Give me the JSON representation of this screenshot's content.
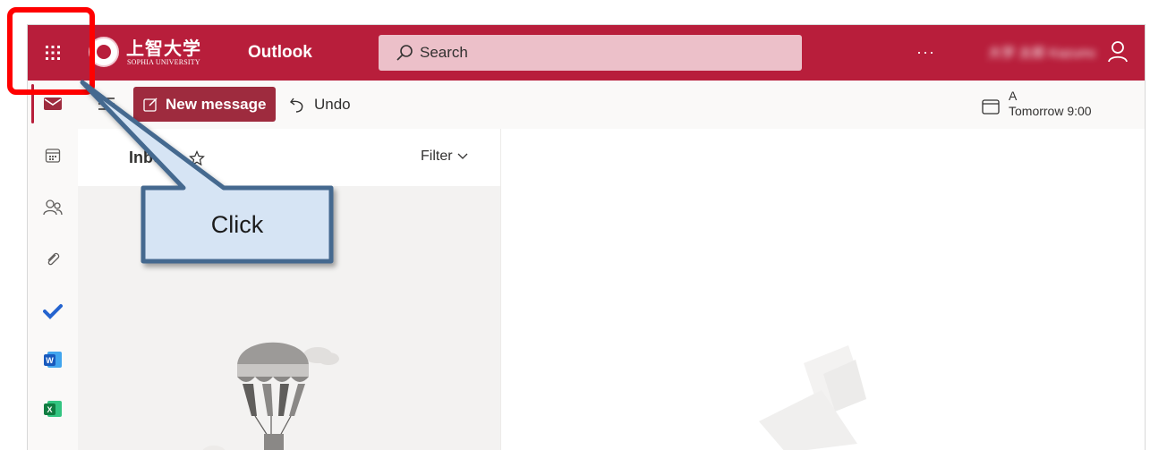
{
  "header": {
    "university_name_jp": "上智大学",
    "university_name_en": "SOPHIA UNIVERSITY",
    "app_name": "Outlook",
    "search_placeholder": "Search",
    "more_label": "···",
    "user_name": "大学 太郎 Kazuma",
    "brand_color": "#b81e3b"
  },
  "rail": {
    "items": [
      {
        "name": "mail-icon",
        "active": true
      },
      {
        "name": "calendar-icon"
      },
      {
        "name": "people-icon"
      },
      {
        "name": "attachment-icon"
      },
      {
        "name": "todo-check-icon"
      },
      {
        "name": "word-icon",
        "letter": "W"
      },
      {
        "name": "excel-icon",
        "letter": "X"
      }
    ]
  },
  "commandbar": {
    "new_message_label": "New message",
    "undo_label": "Undo",
    "reminder_title": "A",
    "reminder_time": "Tomorrow 9:00"
  },
  "list": {
    "folder_name": "Inbox",
    "filter_label": "Filter"
  },
  "annotation": {
    "callout_text": "Click",
    "highlight_color": "#ff0000"
  }
}
